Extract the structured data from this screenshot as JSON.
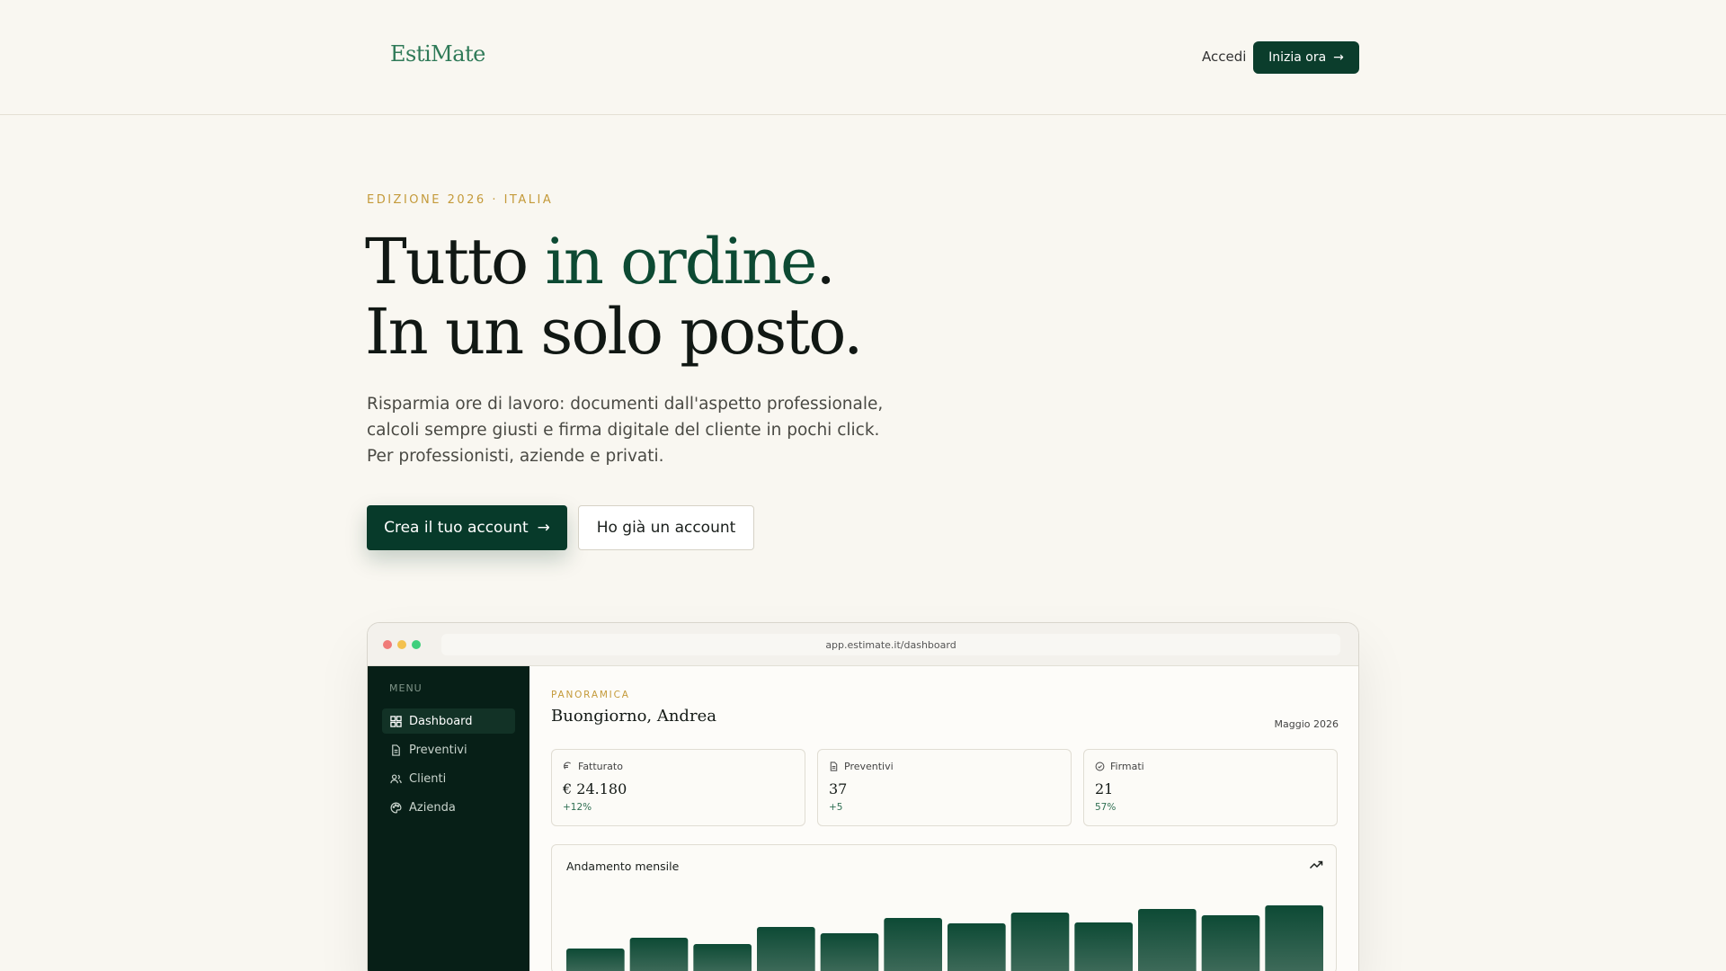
{
  "header": {
    "logo": "EstiMate",
    "login_label": "Accedi",
    "cta_label": "Inizia ora"
  },
  "hero": {
    "eyebrow": "EDIZIONE 2026 · ITALIA",
    "title_part1": "Tutto ",
    "title_accent": "in ordine",
    "title_part2": ".",
    "title_line2": "In un solo posto.",
    "subtitle_line1": "Risparmia ore di lavoro: documenti dall'aspetto professionale,",
    "subtitle_line2": "calcoli sempre giusti e firma digitale del cliente in pochi click.",
    "subtitle_line3": "Per professionisti, aziende e privati.",
    "primary_button": "Crea il tuo account",
    "secondary_button": "Ho già un account"
  },
  "app": {
    "url": "app.estimate.it/dashboard",
    "menu_label": "MENU",
    "sidebar_items": [
      {
        "label": "Dashboard",
        "icon": "grid-icon",
        "active": true
      },
      {
        "label": "Preventivi",
        "icon": "document-icon",
        "active": false
      },
      {
        "label": "Clienti",
        "icon": "users-icon",
        "active": false
      },
      {
        "label": "Azienda",
        "icon": "palette-icon",
        "active": false
      }
    ],
    "eyebrow": "PANORAMICA",
    "greeting": "Buongiorno, Andrea",
    "month": "Maggio 2026",
    "cards": [
      {
        "title": "Fatturato",
        "icon": "euro-icon",
        "value": "€ 24.180",
        "delta": "+12%"
      },
      {
        "title": "Preventivi",
        "icon": "document-icon",
        "value": "37",
        "delta": "+5"
      },
      {
        "title": "Firmati",
        "icon": "check-circle-icon",
        "value": "21",
        "delta": "57%"
      }
    ],
    "chart_title": "Andamento mensile",
    "colors": {
      "bar_top": "#0d4a35",
      "bar_bottom": "#3f6b5a",
      "accent": "#0b3d2c",
      "gold": "#c49a3a"
    }
  },
  "chart_data": {
    "type": "bar",
    "title": "Andamento mensile",
    "values": [
      28,
      40,
      33,
      52,
      45,
      62,
      56,
      68,
      57,
      72,
      65,
      76
    ],
    "ylim": [
      0,
      80
    ]
  }
}
